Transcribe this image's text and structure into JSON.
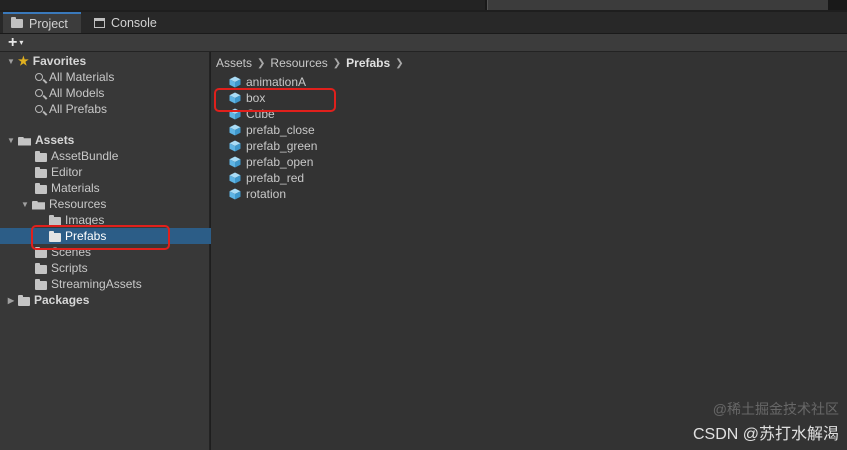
{
  "tabs": [
    {
      "label": "Project",
      "icon": "folder-icon",
      "active": true
    },
    {
      "label": "Console",
      "icon": "console-icon",
      "active": false
    }
  ],
  "toolbar": {
    "add_label": "+",
    "add_caret": "▾"
  },
  "tree": {
    "favorites": {
      "label": "Favorites",
      "items": [
        "All Materials",
        "All Models",
        "All Prefabs"
      ]
    },
    "assets": {
      "label": "Assets",
      "children": [
        {
          "label": "AssetBundle"
        },
        {
          "label": "Editor"
        },
        {
          "label": "Materials"
        },
        {
          "label": "Resources",
          "expanded": true,
          "children": [
            {
              "label": "Images"
            },
            {
              "label": "Prefabs",
              "selected": true
            }
          ]
        },
        {
          "label": "Scenes"
        },
        {
          "label": "Scripts"
        },
        {
          "label": "StreamingAssets"
        }
      ]
    },
    "packages": {
      "label": "Packages"
    }
  },
  "breadcrumb": [
    "Assets",
    "Resources",
    "Prefabs"
  ],
  "assets_list": [
    "animationA",
    "box",
    "Cube",
    "prefab_close",
    "prefab_green",
    "prefab_open",
    "prefab_red",
    "rotation"
  ],
  "watermark": {
    "line1": "@稀土掘金技术社区",
    "line2": "CSDN @苏打水解渴"
  },
  "colors": {
    "selection": "#2c5d87",
    "highlight": "#e0201c",
    "prefab_icon": "#7ec8f0",
    "star": "#e0b020"
  }
}
